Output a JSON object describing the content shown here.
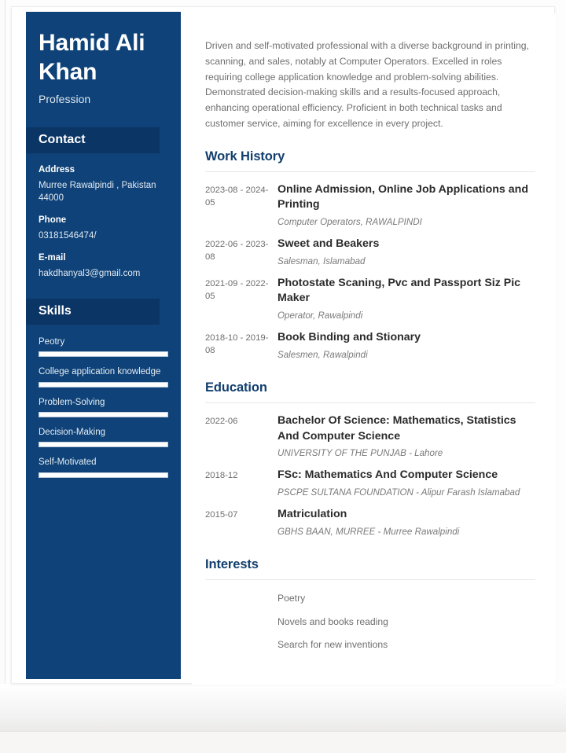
{
  "sidebar": {
    "name": "Hamid Ali Khan",
    "profession": "Profession",
    "contact_heading": "Contact",
    "contact": {
      "address_label": "Address",
      "address_value": "Murree Rawalpindi , Pakistan 44000",
      "phone_label": "Phone",
      "phone_value": "03181546474/",
      "email_label": "E-mail",
      "email_value": "hakdhanyal3@gmail.com"
    },
    "skills_heading": "Skills",
    "skills": [
      {
        "name": "Peotry",
        "level": 100
      },
      {
        "name": "College application knowledge",
        "level": 100
      },
      {
        "name": "Problem-Solving",
        "level": 100
      },
      {
        "name": "Decision-Making",
        "level": 100
      },
      {
        "name": "Self-Motivated",
        "level": 100
      }
    ]
  },
  "main": {
    "summary": "Driven and self-motivated professional with a diverse background in printing, scanning, and sales, notably at Computer Operators. Excelled in roles requiring college application knowledge and problem-solving abilities. Demonstrated decision-making skills and a results-focused approach, enhancing operational efficiency. Proficient in both technical tasks and customer service, aiming for excellence in every project.",
    "work_history": {
      "title": "Work History",
      "entries": [
        {
          "date": "2023-08 - 2024-05",
          "title": "Online Admission, Online Job Applications and Printing",
          "subtitle": "Computer Operators, RAWALPINDI"
        },
        {
          "date": "2022-06 - 2023-08",
          "title": "Sweet and Beakers",
          "subtitle": "Salesman, Islamabad"
        },
        {
          "date": "2021-09 - 2022-05",
          "title": "Photostate Scaning, Pvc and Passport Siz Pic Maker",
          "subtitle": "Operator, Rawalpindi"
        },
        {
          "date": "2018-10 - 2019-08",
          "title": "Book Binding and Stionary",
          "subtitle": "Salesmen, Rawalpindi"
        }
      ]
    },
    "education": {
      "title": "Education",
      "entries": [
        {
          "date": "2022-06",
          "title": "Bachelor Of Science: Mathematics, Statistics And Computer Science",
          "subtitle": "UNIVERSITY OF THE PUNJAB - Lahore"
        },
        {
          "date": "2018-12",
          "title": "FSc: Mathematics And Computer Science",
          "subtitle": "PSCPE SULTANA FOUNDATION - Alipur Farash Islamabad"
        },
        {
          "date": "2015-07",
          "title": "Matriculation",
          "subtitle": "GBHS BAAN, MURREE - Murree Rawalpindi"
        }
      ]
    },
    "interests": {
      "title": "Interests",
      "items": [
        "Poetry",
        "Novels and books reading",
        "Search for new inventions"
      ]
    }
  },
  "colors": {
    "sidebar_blue": "#0e4278",
    "sidebar_band_blue": "#0b3565",
    "heading_blue": "#123f6e",
    "body_gray": "#6f6f6f"
  }
}
